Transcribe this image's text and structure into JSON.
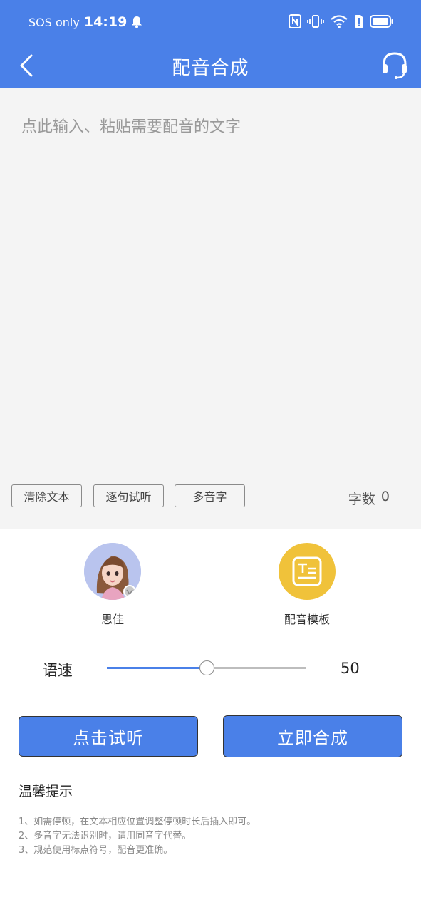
{
  "status_bar": {
    "carrier": "SOS only",
    "time": "14:19",
    "network_label": "6"
  },
  "app_bar": {
    "title": "配音合成",
    "back_icon": "chevron-left-icon",
    "support_icon": "headset-icon"
  },
  "editor": {
    "placeholder": "点此输入、粘贴需要配音的文字",
    "buttons": [
      "清除文本",
      "逐句试听",
      "多音字"
    ],
    "count_label": "字数",
    "count_value": "0"
  },
  "voice": {
    "name": "思佳",
    "avatar_icon": "female-avatar-icon"
  },
  "template": {
    "label": "配音模板",
    "icon": "text-template-icon",
    "color": "#f0c23a"
  },
  "speed": {
    "label": "语速",
    "value": "50",
    "min": 0,
    "max": 100
  },
  "actions": {
    "preview": "点击试听",
    "synthesize": "立即合成"
  },
  "tips": {
    "title": "温馨提示",
    "items": [
      "1、如需停顿，在文本相应位置调整停顿时长后插入即可。",
      "2、多音字无法识别时，请用同音字代替。",
      "3、规范使用标点符号，配音更准确。"
    ]
  },
  "colors": {
    "accent": "#4a80e8",
    "editor_bg": "#f4f4f4"
  }
}
